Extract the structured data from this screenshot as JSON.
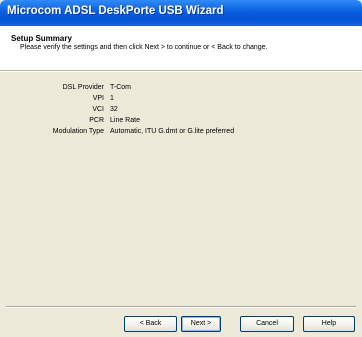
{
  "window": {
    "title": "Microcom ADSL DeskPorte USB Wizard"
  },
  "header": {
    "title": "Setup Summary",
    "subtitle": "Please verify the settings and then click Next > to continue or < Back to change."
  },
  "summary": {
    "rows": [
      {
        "label": "DSL Provider",
        "value": "T-Com"
      },
      {
        "label": "VPI",
        "value": "1"
      },
      {
        "label": "VCI",
        "value": "32"
      },
      {
        "label": "PCR",
        "value": "Line Rate"
      },
      {
        "label": "Modulation Type",
        "value": "Automatic, ITU G.dmt or G.lite preferred"
      }
    ]
  },
  "buttons": {
    "back": "< Back",
    "next": "Next >",
    "cancel": "Cancel",
    "help": "Help"
  }
}
